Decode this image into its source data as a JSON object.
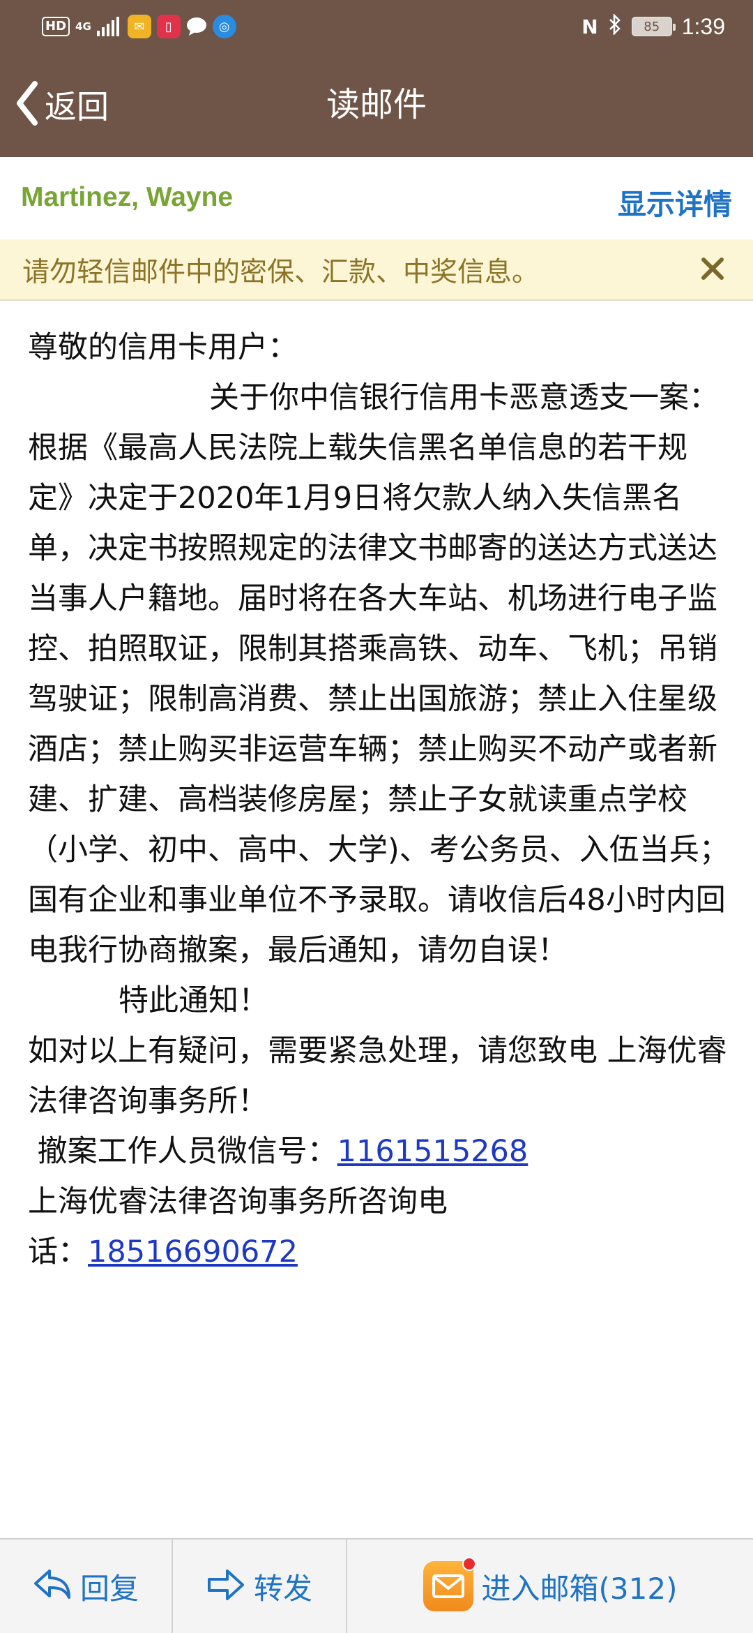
{
  "status_bar": {
    "hd": "HD",
    "network": "4G",
    "battery": "85",
    "time": "1:39",
    "icons": [
      "signal-icon",
      "mail-app-icon",
      "book-app-icon",
      "chat-bubble-icon",
      "browser-app-icon",
      "nfc-icon",
      "bluetooth-icon",
      "battery-icon"
    ]
  },
  "header": {
    "back_label": "返回",
    "title": "读邮件"
  },
  "sender": {
    "name": "Martinez, Wayne",
    "details_label": "显示详情"
  },
  "banner": {
    "text": "请勿轻信邮件中的密保、汇款、中奖信息。"
  },
  "body": {
    "greeting": "尊敬的信用卡用户：",
    "paragraph": "关于你中信银行信用卡恶意透支一案：根据《最高人民法院上载失信黑名单信息的若干规定》决定于2020年1月9日将欠款人纳入失信黑名单，决定书按照规定的法律文书邮寄的送达方式送达当事人户籍地。届时将在各大车站、机场进行电子监控、拍照取证，限制其搭乘高铁、动车、飞机；吊销驾驶证；限制高消费、禁止出国旅游；禁止入住星级酒店；禁止购买非运营车辆；禁止购买不动产或者新建、扩建、高档装修房屋；禁止子女就读重点学校（小学、初中、高中、大学)、考公务员、入伍当兵；国有企业和事业单位不予录取。请收信后48小时内回电我行协商撤案，最后通知，请勿自误！",
    "special_notice": "特此通知！",
    "inquiry": "如对以上有疑问，需要紧急处理，请您致电 上海优睿法律咨询事务所！",
    "wechat_label": " 撤案工作人员微信号：",
    "wechat_id": "1161515268",
    "phone_label_line1": "上海优睿法律咨询事务所咨询电",
    "phone_label_line2": "话：",
    "phone": "18516690672"
  },
  "bottom_bar": {
    "reply_label": "回复",
    "forward_label": "转发",
    "inbox_label": "进入邮箱(312)"
  },
  "colors": {
    "header_bg": "#6e5547",
    "sender_green": "#79a436",
    "accent_blue": "#1f73c4",
    "banner_bg": "#fdf6d6",
    "banner_text": "#8b7427",
    "link": "#1d39c4"
  }
}
